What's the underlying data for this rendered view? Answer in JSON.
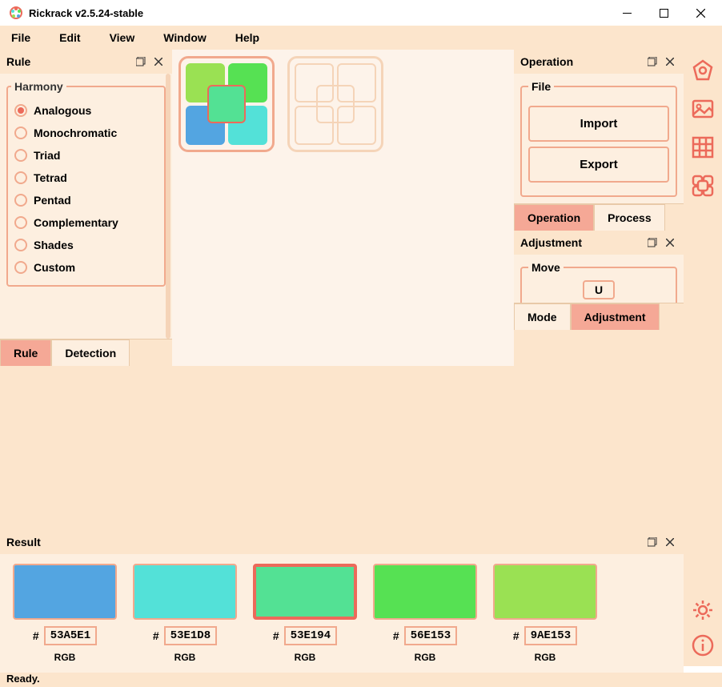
{
  "window": {
    "title": "Rickrack v2.5.24-stable"
  },
  "menu": {
    "file": "File",
    "edit": "Edit",
    "view": "View",
    "window": "Window",
    "help": "Help"
  },
  "rule": {
    "title": "Rule",
    "group_label": "Harmony",
    "options": [
      "Analogous",
      "Monochromatic",
      "Triad",
      "Tetrad",
      "Pentad",
      "Complementary",
      "Shades",
      "Custom"
    ],
    "tabs": {
      "rule": "Rule",
      "detection": "Detection"
    }
  },
  "operation": {
    "title": "Operation",
    "file_label": "File",
    "import": "Import",
    "export": "Export",
    "tabs": {
      "operation": "Operation",
      "process": "Process"
    }
  },
  "adjustment": {
    "title": "Adjustment",
    "move_label": "Move",
    "u": "U",
    "tabs": {
      "mode": "Mode",
      "adjustment": "Adjustment"
    }
  },
  "result": {
    "title": "Result",
    "hash": "#",
    "rgb": "RGB",
    "swatches": [
      {
        "hex": "53A5E1",
        "color": "#53A5E1"
      },
      {
        "hex": "53E1D8",
        "color": "#53E1D8"
      },
      {
        "hex": "53E194",
        "color": "#53E194"
      },
      {
        "hex": "56E153",
        "color": "#56E153"
      },
      {
        "hex": "9AE153",
        "color": "#9AE153"
      }
    ]
  },
  "status": "Ready."
}
